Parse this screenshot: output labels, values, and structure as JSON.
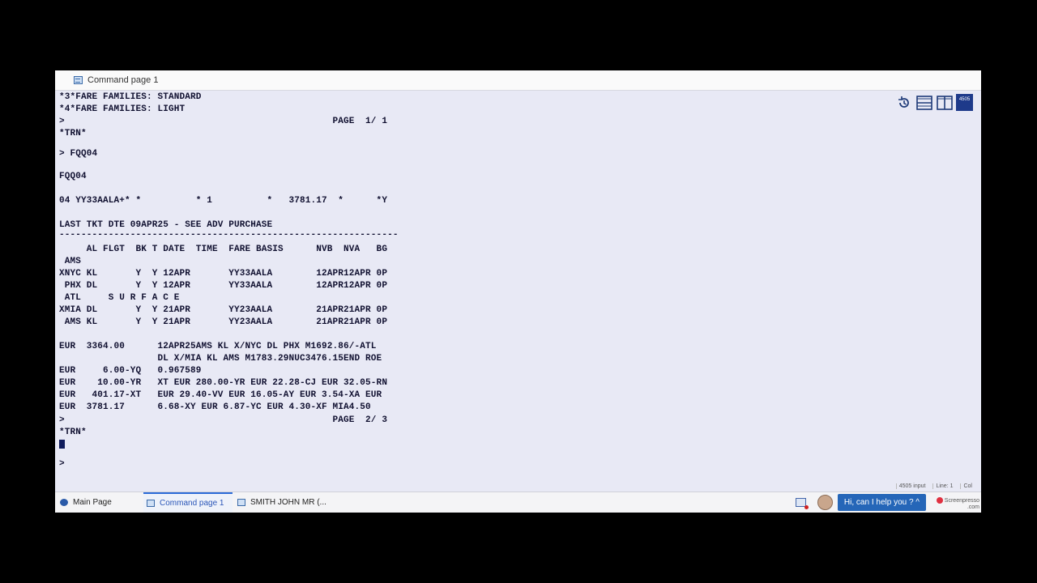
{
  "window": {
    "title": "Command page 1"
  },
  "toolbar": {
    "badge_label": "4505"
  },
  "terminal": {
    "lines": [
      "*3*FARE FAMILIES: STANDARD",
      "*4*FARE FAMILIES: LIGHT",
      ">                                                 PAGE  1/ 1",
      "*TRN*",
      "> FQQ04",
      "FQQ04",
      "04 YY33AALA+* *          * 1          *   3781.17  *      *Y",
      "LAST TKT DTE 09APR25 - SEE ADV PURCHASE",
      "--------------------------------------------------------------",
      "     AL FLGT  BK T DATE  TIME  FARE BASIS      NVB  NVA   BG",
      " AMS",
      "XNYC KL       Y  Y 12APR       YY33AALA        12APR12APR 0P",
      " PHX DL       Y  Y 12APR       YY33AALA        12APR12APR 0P",
      " ATL     S U R F A C E",
      "XMIA DL       Y  Y 21APR       YY23AALA        21APR21APR 0P",
      " AMS KL       Y  Y 21APR       YY23AALA        21APR21APR 0P",
      "EUR  3364.00      12APR25AMS KL X/NYC DL PHX M1692.86/-ATL",
      "                  DL X/MIA KL AMS M1783.29NUC3476.15END ROE",
      "EUR     6.00-YQ   0.967589",
      "EUR    10.00-YR   XT EUR 280.00-YR EUR 22.28-CJ EUR 32.05-RN",
      "EUR   401.17-XT   EUR 29.40-VV EUR 16.05-AY EUR 3.54-XA EUR",
      "EUR  3781.17      6.68-XY EUR 6.87-YC EUR 4.30-XF MIA4.50",
      ">                                                 PAGE  2/ 3",
      "*TRN*",
      ">"
    ]
  },
  "status": {
    "mode": "4505 input",
    "line": "Line: 1",
    "col": "Col"
  },
  "taskbar": {
    "tabs": [
      {
        "label": "Main Page"
      },
      {
        "label": "Command page 1"
      },
      {
        "label": "SMITH JOHN MR (..."
      }
    ],
    "help_label": "Hi, can I help you ? ^"
  },
  "watermark": {
    "line1": "Screenpresso",
    "line2": ".com"
  },
  "colors": {
    "background": "#e8e9f5",
    "text": "#101030",
    "accent": "#2566b8"
  }
}
